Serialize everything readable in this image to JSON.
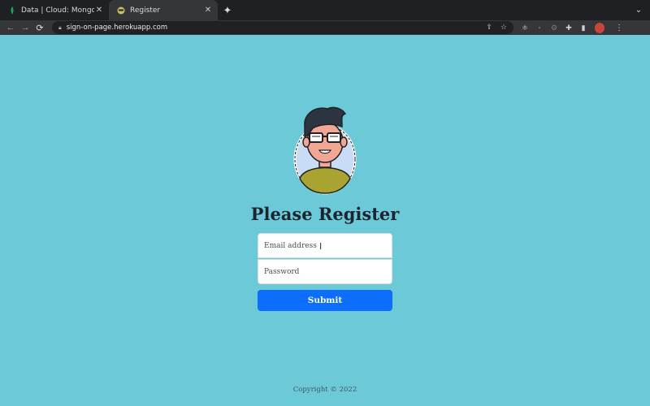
{
  "browser": {
    "tabs": [
      {
        "title": "Data | Cloud: MongoDB Cloud",
        "icon": "mongodb-leaf-icon",
        "active": false
      },
      {
        "title": "Register",
        "icon": "site-favicon-icon",
        "active": true
      }
    ],
    "url": "sign-on-page.herokuapp.com"
  },
  "page": {
    "heading": "Please Register",
    "email_placeholder": "Email address",
    "password_placeholder": "Password",
    "submit_label": "Submit",
    "footer": "Copyright © 2022"
  },
  "colors": {
    "background": "#6ccad8",
    "button": "#0d6efd",
    "heading": "#1c2430"
  }
}
